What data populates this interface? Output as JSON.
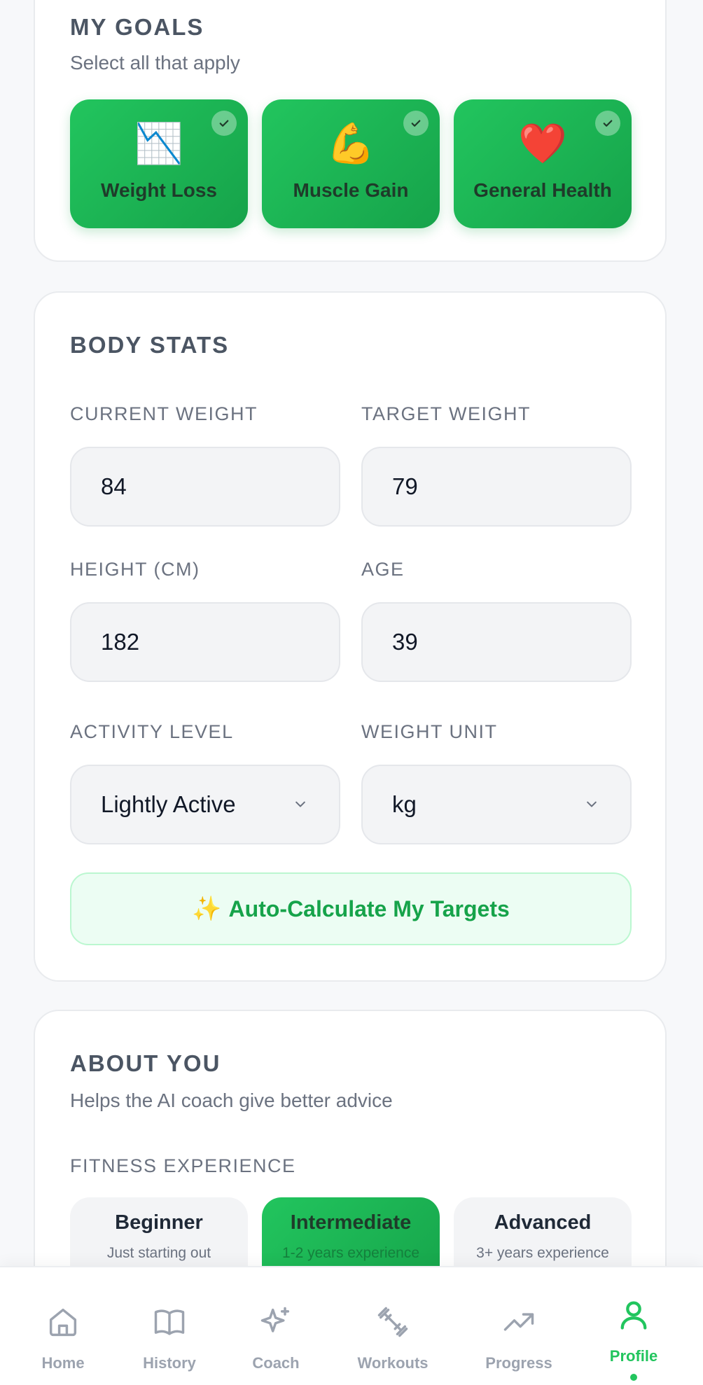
{
  "goals": {
    "title": "MY GOALS",
    "subtitle": "Select all that apply",
    "items": [
      {
        "emoji": "📉",
        "label": "Weight Loss",
        "selected": true
      },
      {
        "emoji": "💪",
        "label": "Muscle Gain",
        "selected": true
      },
      {
        "emoji": "❤️",
        "label": "General Health",
        "selected": true
      }
    ]
  },
  "body_stats": {
    "title": "BODY STATS",
    "current_weight": {
      "label": "CURRENT WEIGHT",
      "value": "84"
    },
    "target_weight": {
      "label": "TARGET WEIGHT",
      "value": "79"
    },
    "height": {
      "label": "HEIGHT (CM)",
      "value": "182"
    },
    "age": {
      "label": "AGE",
      "value": "39"
    },
    "activity_level": {
      "label": "ACTIVITY LEVEL",
      "value": "Lightly Active"
    },
    "weight_unit": {
      "label": "WEIGHT UNIT",
      "value": "kg"
    },
    "auto_button": {
      "icon": "✨",
      "label": "Auto-Calculate My Targets"
    }
  },
  "about": {
    "title": "ABOUT YOU",
    "subtitle": "Helps the AI coach give better advice",
    "experience_label": "FITNESS EXPERIENCE",
    "experience": [
      {
        "title": "Beginner",
        "desc": "Just starting out",
        "selected": false
      },
      {
        "title": "Intermediate",
        "desc": "1-2 years experience",
        "selected": true
      },
      {
        "title": "Advanced",
        "desc": "3+ years experience",
        "selected": false
      }
    ]
  },
  "nav": {
    "items": [
      {
        "label": "Home",
        "icon": "home-icon"
      },
      {
        "label": "History",
        "icon": "book-icon"
      },
      {
        "label": "Coach",
        "icon": "sparkles-icon"
      },
      {
        "label": "Workouts",
        "icon": "dumbbell-icon"
      },
      {
        "label": "Progress",
        "icon": "trending-up-icon"
      },
      {
        "label": "Profile",
        "icon": "user-icon",
        "active": true
      }
    ]
  },
  "colors": {
    "accent": "#22c55e",
    "accent_dark": "#16a34a",
    "muted": "#9ca3af"
  }
}
